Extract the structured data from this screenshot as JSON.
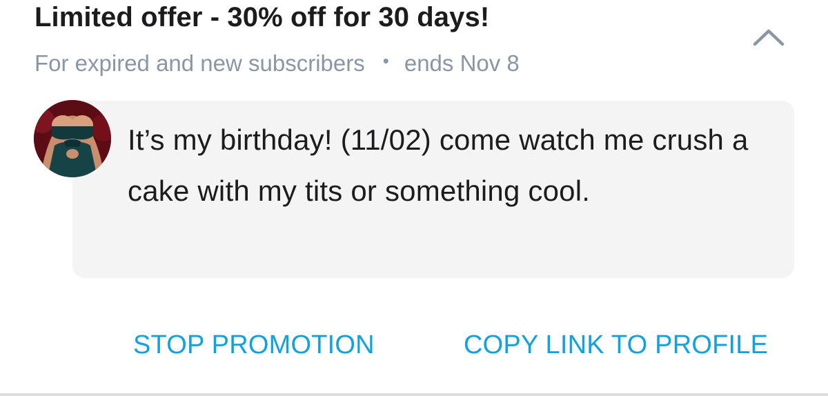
{
  "promo": {
    "title": "Limited offer - 30% off for 30 days!",
    "audience": "For expired and new subscribers",
    "separator": "•",
    "ends": "ends Nov 8",
    "message": "It’s my birthday! (11/02) come watch me crush a cake with my tits or something cool."
  },
  "actions": {
    "stop_label": "STOP PROMOTION",
    "copy_label": "COPY LINK TO PROFILE"
  },
  "icons": {
    "collapse": "chevron-up-icon",
    "avatar": "avatar"
  },
  "colors": {
    "title": "#1c1c1e",
    "muted": "#8a96a3",
    "accent": "#0fa2e0",
    "bubble": "#f4f4f4"
  }
}
